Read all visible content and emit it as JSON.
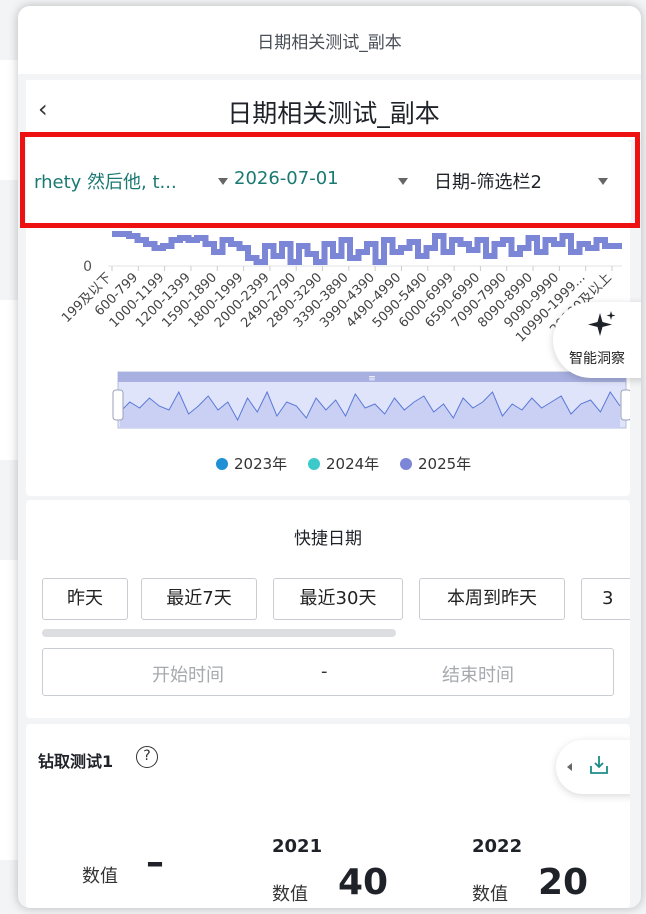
{
  "window": {
    "title": "日期相关测试_副本"
  },
  "nav": {
    "back_icon": "chevron-left-icon",
    "back_glyph": "‹",
    "title": "日期相关测试_副本"
  },
  "filters": [
    {
      "label": "rhety 然后他, t...",
      "color": "#1a7a72"
    },
    {
      "label": "2026-07-01",
      "color": "#1a7a72"
    },
    {
      "label": "日期-筛选栏2",
      "color": "#1f2329"
    }
  ],
  "chart": {
    "y_tick_zero": "0",
    "categories": [
      "199及以下",
      "600-799",
      "1000-1199",
      "1200-1399",
      "1590-1890",
      "1800-1999",
      "2000-2399",
      "2490-2790",
      "2890-3290",
      "3390-3890",
      "3990-4390",
      "4490-4990",
      "5090-5490",
      "6000-6999",
      "6590-6990",
      "7090-7990",
      "8090-8990",
      "9090-9990",
      "10990-1999...",
      "20990及以上"
    ],
    "legend": [
      {
        "name": "2023年",
        "color": "#1f8fd6"
      },
      {
        "name": "2024年",
        "color": "#3cc9c9"
      },
      {
        "name": "2025年",
        "color": "#7c86d6"
      }
    ],
    "zoom_handle_glyph": "≡"
  },
  "chart_data": {
    "type": "line",
    "y_visible_tick": "0",
    "legend_position": "bottom",
    "series": [
      {
        "name": "2023年",
        "values": []
      },
      {
        "name": "2024年",
        "values": []
      },
      {
        "name": "2025年",
        "values": []
      }
    ]
  },
  "insight": {
    "label": "智能洞察",
    "icon": "sparkle-icon"
  },
  "quick_date": {
    "title": "快捷日期",
    "buttons": [
      "昨天",
      "最近7天",
      "最近30天",
      "本周到昨天",
      "3"
    ],
    "start_placeholder": "开始时间",
    "separator": "-",
    "end_placeholder": "结束时间"
  },
  "drill": {
    "title": "钻取测试1",
    "help_glyph": "?",
    "export_icon": "download-icon",
    "kpi_label": "数值",
    "kpi_value": "–",
    "years": [
      {
        "year": "2021",
        "label": "数值",
        "value": "40"
      },
      {
        "year": "2022",
        "label": "数值",
        "value": "20"
      }
    ]
  }
}
